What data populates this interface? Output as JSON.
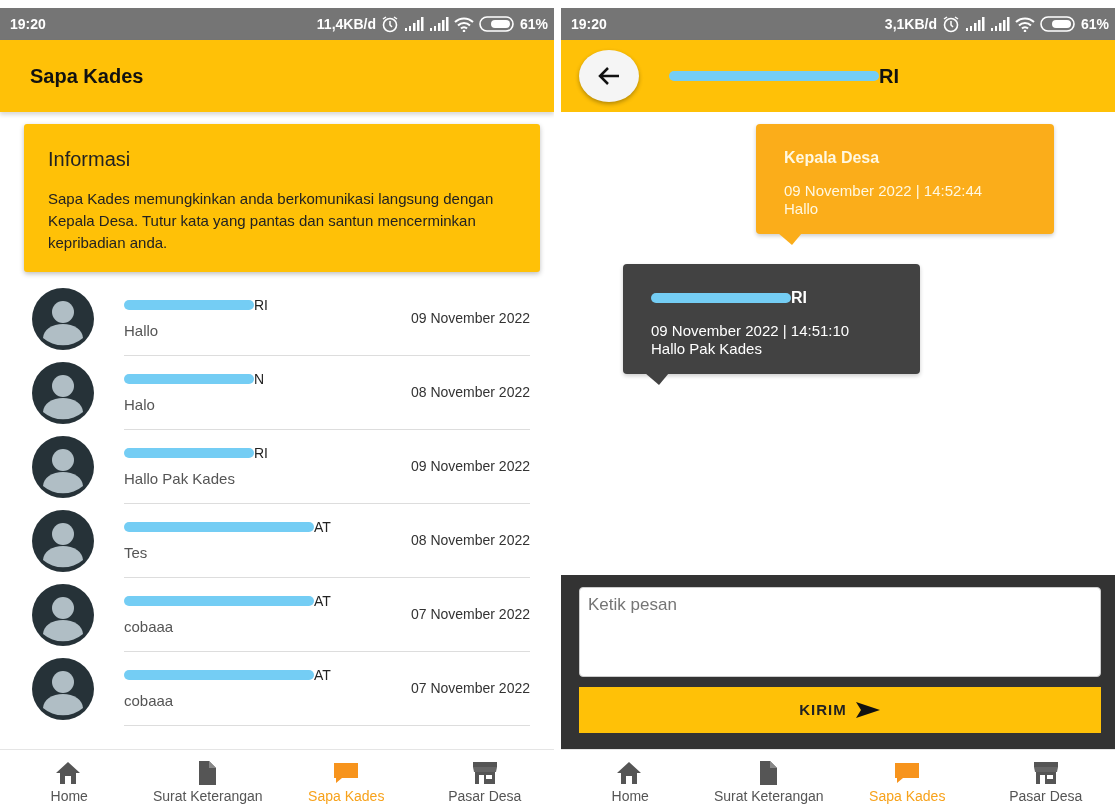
{
  "list_screen": {
    "status_bar": {
      "time": "19:20",
      "speed": "11,4KB/d",
      "battery": "61%"
    },
    "title": "Sapa Kades",
    "info": {
      "title": "Informasi",
      "text": "Sapa Kades memungkinkan anda berkomunikasi langsung dengan Kepala Desa. Tutur kata yang pantas dan santun mencerminkan kepribadian anda."
    },
    "conversations": [
      {
        "name": "RI",
        "message": "Hallo",
        "date": "09 November 2022"
      },
      {
        "name": "N",
        "message": "Halo",
        "date": "08 November 2022"
      },
      {
        "name": "RI",
        "message": "Hallo Pak Kades",
        "date": "09 November 2022"
      },
      {
        "name": "AT",
        "message": "Tes",
        "date": "08 November 2022"
      },
      {
        "name": "AT",
        "message": "cobaaa",
        "date": "07 November 2022"
      },
      {
        "name": "AT",
        "message": "cobaaa",
        "date": "07 November 2022"
      }
    ],
    "nav": [
      {
        "label": "Home",
        "selected": false
      },
      {
        "label": "Surat Keterangan",
        "selected": false
      },
      {
        "label": "Sapa Kades",
        "selected": true
      },
      {
        "label": "Pasar Desa",
        "selected": false
      }
    ]
  },
  "chat_screen": {
    "status_bar": {
      "time": "19:20",
      "speed": "3,1KB/d",
      "battery": "61%"
    },
    "title": "RI",
    "messages": [
      {
        "kind": "outgoing",
        "sender": "Kepala Desa",
        "time": "09 November 2022 | 14:52:44",
        "text": "Hallo"
      },
      {
        "kind": "incoming",
        "sender": "RI",
        "time": "09 November 2022 | 14:51:10",
        "text": "Hallo Pak Kades"
      }
    ],
    "input": {
      "placeholder": "Ketik pesan"
    },
    "send_button": "KIRIM",
    "nav": [
      {
        "label": "Home",
        "selected": false
      },
      {
        "label": "Surat Keterangan",
        "selected": false
      },
      {
        "label": "Sapa Kades",
        "selected": true
      },
      {
        "label": "Pasar Desa",
        "selected": false
      }
    ]
  }
}
